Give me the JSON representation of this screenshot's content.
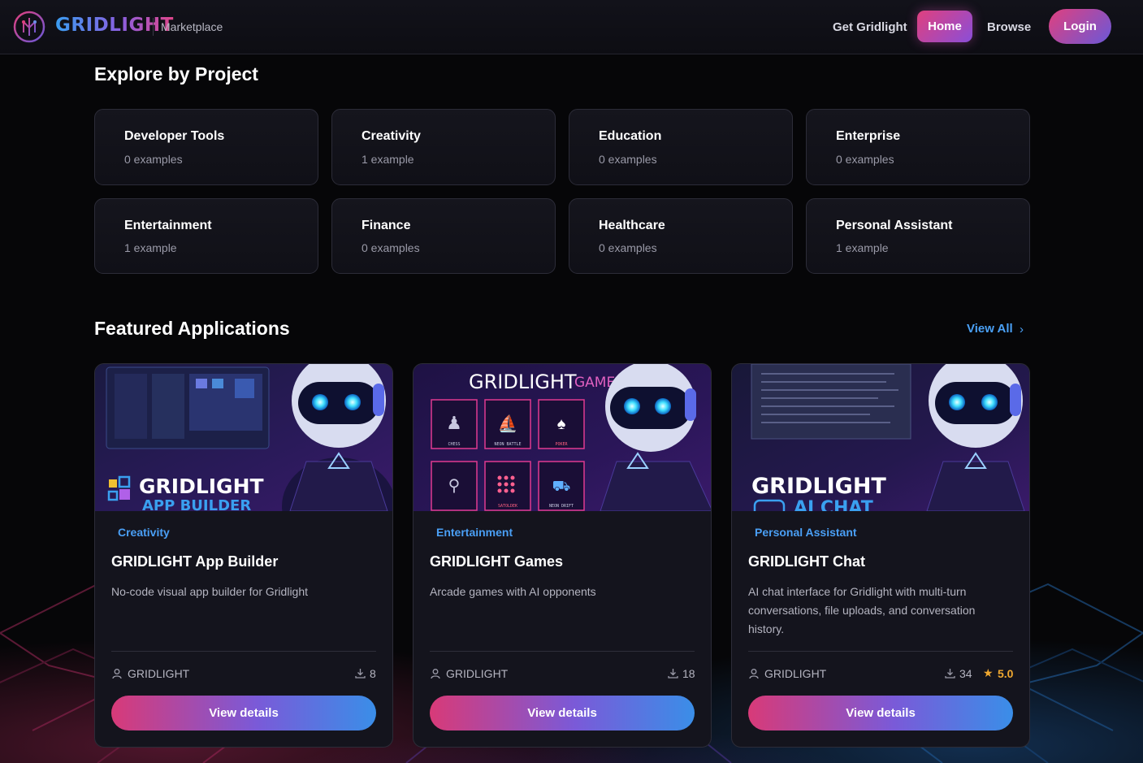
{
  "header": {
    "brand": "GRIDLIGHT",
    "subtitle": "Marketplace",
    "nav": {
      "get": "Get Gridlight",
      "home": "Home",
      "browse": "Browse",
      "login": "Login"
    }
  },
  "explore": {
    "title": "Explore by Project",
    "projects": [
      {
        "name": "Developer Tools",
        "count": "0 examples"
      },
      {
        "name": "Creativity",
        "count": "1 example"
      },
      {
        "name": "Education",
        "count": "0 examples"
      },
      {
        "name": "Enterprise",
        "count": "0 examples"
      },
      {
        "name": "Entertainment",
        "count": "1 example"
      },
      {
        "name": "Finance",
        "count": "0 examples"
      },
      {
        "name": "Healthcare",
        "count": "0 examples"
      },
      {
        "name": "Personal Assistant",
        "count": "1 example"
      }
    ]
  },
  "featured": {
    "title": "Featured Applications",
    "view_all": "View All",
    "apps": [
      {
        "category": "Creativity",
        "title": "GRIDLIGHT App Builder",
        "description": "No-code visual app builder for Gridlight",
        "author": "GRIDLIGHT",
        "downloads": "8",
        "rating": "",
        "button": "View details",
        "banner_line1": "GRIDLIGHT",
        "banner_line2": "APP BUILDER"
      },
      {
        "category": "Entertainment",
        "title": "GRIDLIGHT Games",
        "description": "Arcade games with AI opponents",
        "author": "GRIDLIGHT",
        "downloads": "18",
        "rating": "",
        "button": "View details",
        "banner_line1": "GRIDLIGHT",
        "banner_line2": "GAMES",
        "tiles": [
          "CHESS",
          "NEON BATTLE",
          "POKER",
          "",
          "SATOLDEK",
          "NEON DRIFT"
        ]
      },
      {
        "category": "Personal Assistant",
        "title": "GRIDLIGHT Chat",
        "description": "AI chat interface for Gridlight with multi-turn conversations, file uploads, and conversation history.",
        "author": "GRIDLIGHT",
        "downloads": "34",
        "rating": "5.0",
        "button": "View details",
        "banner_line1": "GRIDLIGHT",
        "banner_line2": "AI CHAT"
      }
    ]
  },
  "colors": {
    "accent_blue": "#4a9ff5",
    "accent_pink": "#e0407e",
    "accent_purple": "#8a4ed8",
    "star": "#f0a830"
  }
}
